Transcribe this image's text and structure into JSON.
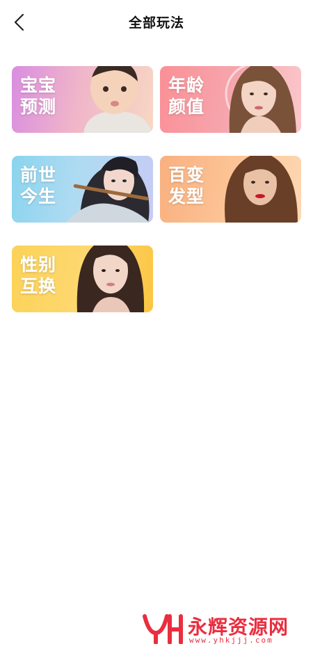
{
  "header": {
    "title": "全部玩法",
    "back_icon": "chevron-left-icon"
  },
  "cards": [
    {
      "id": "baby",
      "label": "宝宝\n预测"
    },
    {
      "id": "age",
      "label": "年龄\n颜值"
    },
    {
      "id": "past",
      "label": "前世\n今生"
    },
    {
      "id": "hair",
      "label": "百变\n发型"
    },
    {
      "id": "gender",
      "label": "性别\n互换"
    }
  ],
  "watermark": {
    "name": "永辉资源网",
    "url": "www.yhkjjj.com"
  },
  "colors": {
    "watermark": "#ea2d3f"
  }
}
